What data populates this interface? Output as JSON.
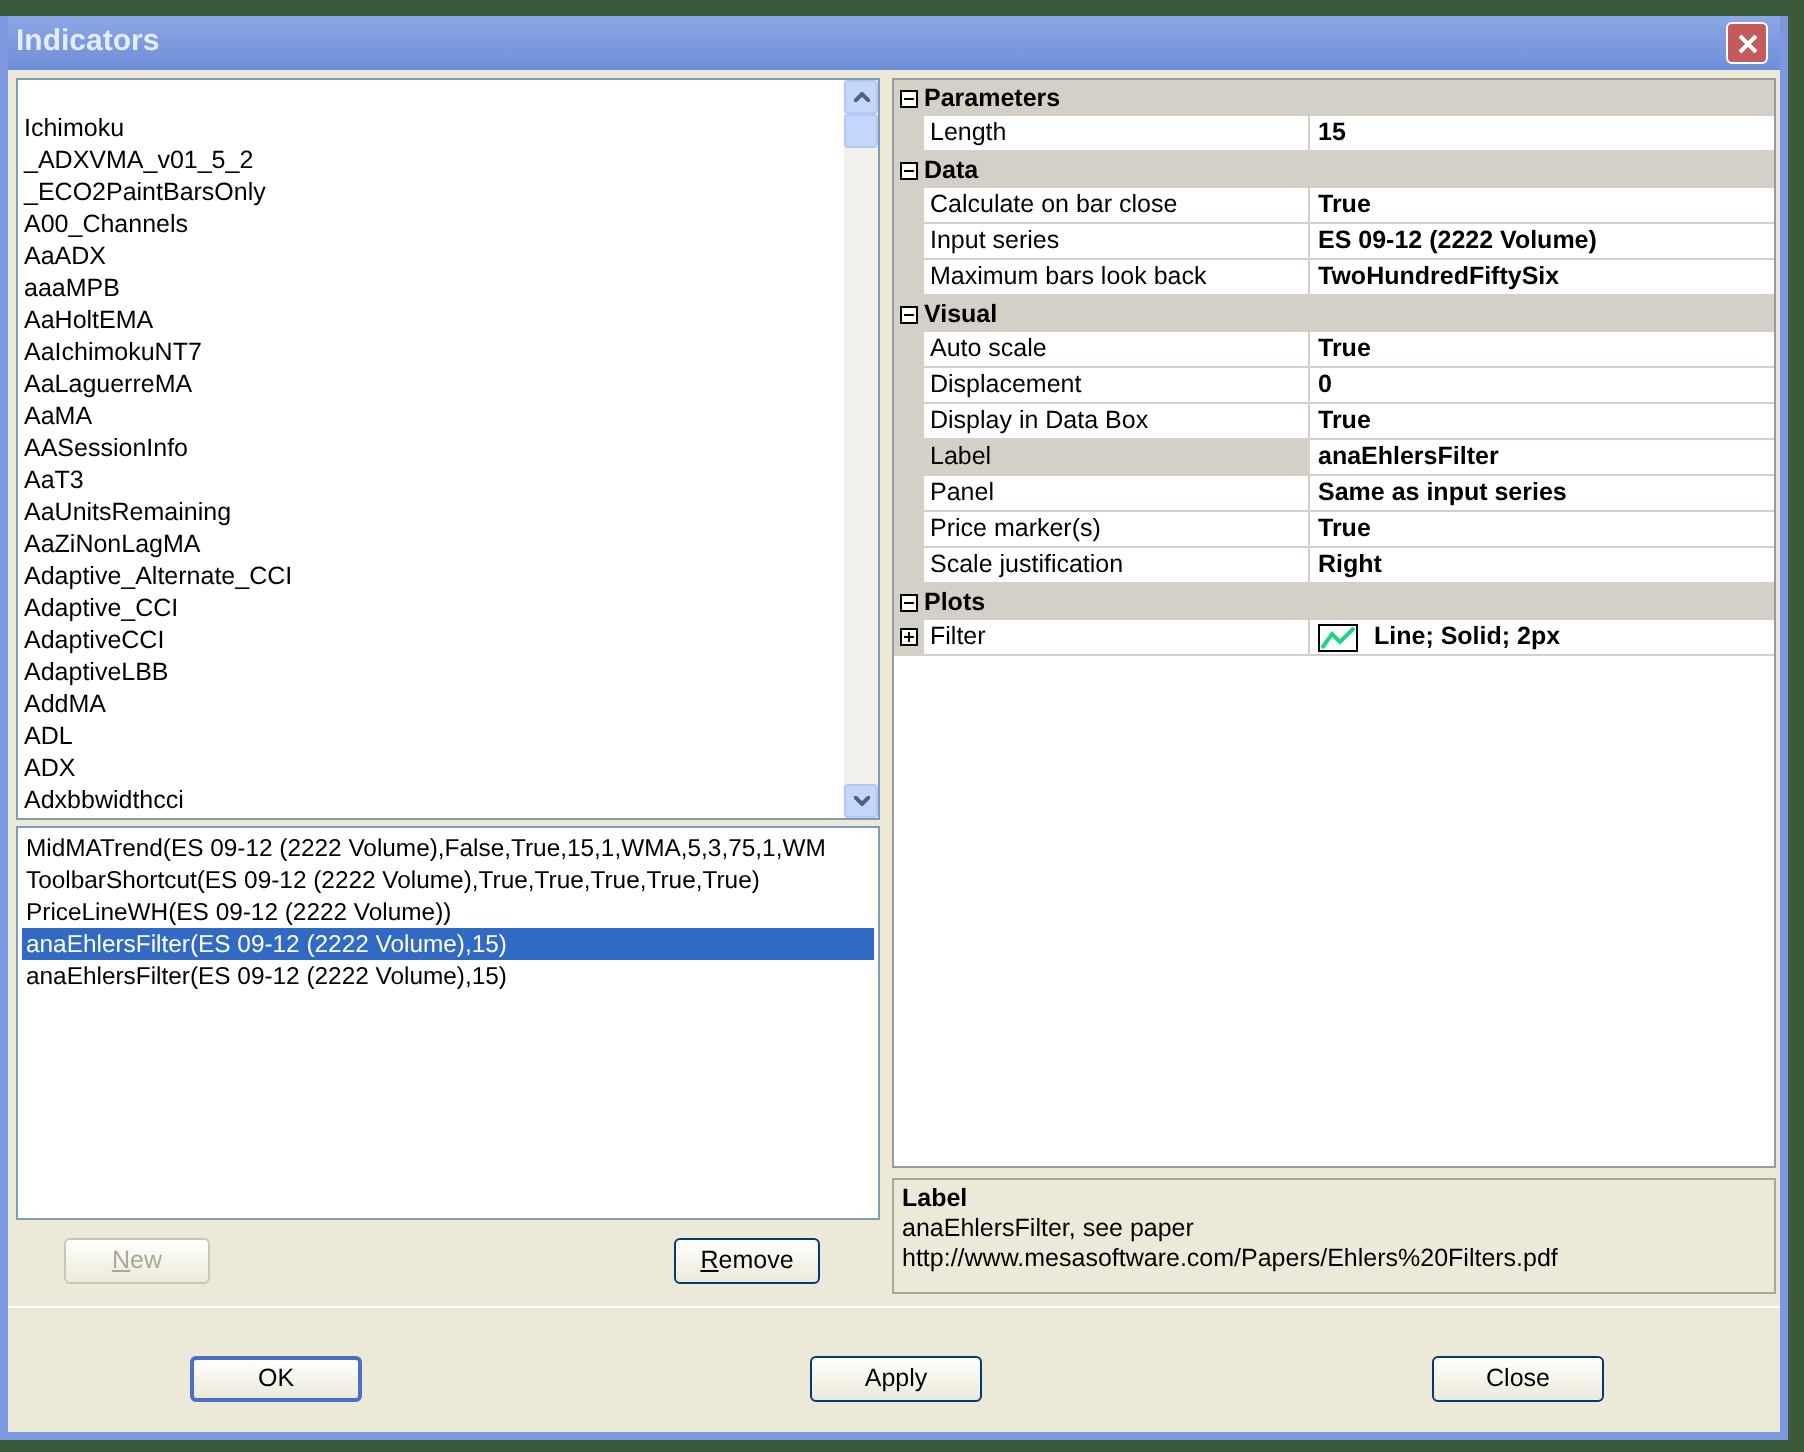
{
  "window": {
    "title": "Indicators"
  },
  "indicator_list": {
    "items": [
      "Ichimoku",
      "_ADXVMA_v01_5_2",
      "_ECO2PaintBarsOnly",
      "A00_Channels",
      "AaADX",
      "aaaMPB",
      "AaHoltEMA",
      "AaIchimokuNT7",
      "AaLaguerreMA",
      "AaMA",
      "AASessionInfo",
      "AaT3",
      "AaUnitsRemaining",
      "AaZiNonLagMA",
      "Adaptive_Alternate_CCI",
      "Adaptive_CCI",
      "AdaptiveCCI",
      "AdaptiveLBB",
      "AddMA",
      "ADL",
      "ADX",
      "Adxbbwidthcci"
    ]
  },
  "applied_list": {
    "items": [
      {
        "text": "MidMATrend(ES 09-12 (2222 Volume),False,True,15,1,WMA,5,3,75,1,WM",
        "selected": false
      },
      {
        "text": "ToolbarShortcut(ES 09-12 (2222 Volume),True,True,True,True,True)",
        "selected": false
      },
      {
        "text": "PriceLineWH(ES 09-12 (2222 Volume))",
        "selected": false
      },
      {
        "text": "anaEhlersFilter(ES 09-12 (2222 Volume),15)",
        "selected": true
      },
      {
        "text": "anaEhlersFilter(ES 09-12 (2222 Volume),15)",
        "selected": false
      }
    ]
  },
  "list_buttons": [
    {
      "label": "New",
      "disabled": true
    },
    {
      "label": "Remove",
      "disabled": false
    }
  ],
  "property_grid": {
    "categories": [
      {
        "name": "Parameters",
        "expanded": true,
        "rows": [
          {
            "kind": "text",
            "label": "Length",
            "value": "15",
            "selected": false
          }
        ]
      },
      {
        "name": "Data",
        "expanded": true,
        "rows": [
          {
            "kind": "text",
            "label": "Calculate on bar close",
            "value": "True",
            "selected": false
          },
          {
            "kind": "text",
            "label": "Input series",
            "value": "ES 09-12 (2222 Volume)",
            "selected": false
          },
          {
            "kind": "text",
            "label": "Maximum bars look back",
            "value": "TwoHundredFiftySix",
            "selected": false
          }
        ]
      },
      {
        "name": "Visual",
        "expanded": true,
        "rows": [
          {
            "kind": "text",
            "label": "Auto scale",
            "value": "True",
            "selected": false
          },
          {
            "kind": "text",
            "label": "Displacement",
            "value": "0",
            "selected": false
          },
          {
            "kind": "text",
            "label": "Display in Data Box",
            "value": "True",
            "selected": false
          },
          {
            "kind": "text",
            "label": "Label",
            "value": "anaEhlersFilter",
            "selected": true
          },
          {
            "kind": "text",
            "label": "Panel",
            "value": "Same as input series",
            "selected": false
          },
          {
            "kind": "text",
            "label": "Price marker(s)",
            "value": "True",
            "selected": false
          },
          {
            "kind": "text",
            "label": "Scale justification",
            "value": "Right",
            "selected": false
          }
        ]
      },
      {
        "name": "Plots",
        "expanded": true,
        "rows": [
          {
            "kind": "plot",
            "label": "Filter",
            "value": "Line; Solid; 2px",
            "selected": false,
            "expanded": false
          }
        ]
      }
    ]
  },
  "description": {
    "title": "Label",
    "lines": [
      "anaEhlersFilter, see paper",
      "http://www.mesasoftware.com/Papers/Ehlers%20Filters.pdf"
    ]
  },
  "dialog_buttons": [
    {
      "label": "OK",
      "default": true
    },
    {
      "label": "Apply",
      "default": false
    },
    {
      "label": "Close",
      "default": false
    }
  ]
}
